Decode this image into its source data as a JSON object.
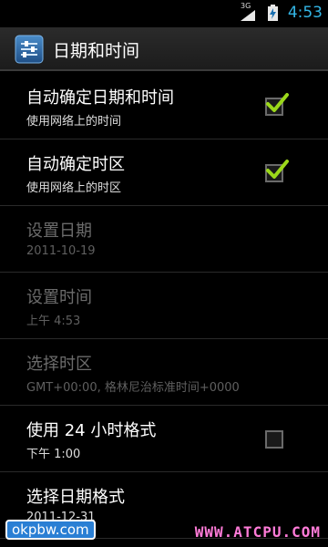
{
  "status_bar": {
    "network": "3G",
    "time": "4:53",
    "icons": [
      "signal-icon",
      "battery-charging-icon"
    ]
  },
  "action_bar": {
    "icon": "settings-sliders-icon",
    "title": "日期和时间"
  },
  "items": [
    {
      "title": "自动确定日期和时间",
      "summary": "使用网络上的时间",
      "enabled": true,
      "checkbox": true,
      "checked": true
    },
    {
      "title": "自动确定时区",
      "summary": "使用网络上的时区",
      "enabled": true,
      "checkbox": true,
      "checked": true
    },
    {
      "title": "设置日期",
      "summary": "2011-10-19",
      "enabled": false
    },
    {
      "title": "设置时间",
      "summary": "上午 4:53",
      "enabled": false
    },
    {
      "title": "选择时区",
      "summary": "GMT+00:00, 格林尼治标准时间+0000",
      "enabled": false
    },
    {
      "title": "使用 24 小时格式",
      "summary": "下午 1:00",
      "enabled": true,
      "checkbox": true,
      "checked": false
    },
    {
      "title": "选择日期格式",
      "summary": "2011-12-31",
      "enabled": true
    }
  ],
  "watermark": {
    "left": "okpbw.com",
    "right": "WWW.ATCPU.COM"
  },
  "colors": {
    "accent": "#33b5e5",
    "check": "#9bd81a"
  }
}
